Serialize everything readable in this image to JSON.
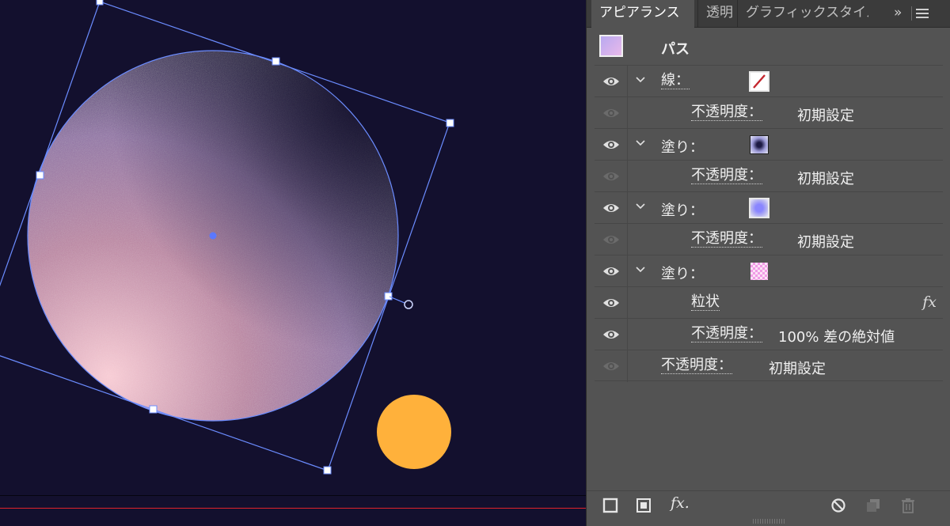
{
  "tabs": [
    {
      "label": "アピアランス",
      "active": true
    },
    {
      "label": "透明",
      "active": false
    },
    {
      "label": "グラフィックスタイル",
      "active": false
    }
  ],
  "tab_overflow": "»",
  "panel_menu_icon": "hamburger-icon",
  "header": {
    "title": "パス"
  },
  "rows": [
    {
      "kind": "stroke",
      "label": "線：",
      "swatch": "stroke-none-swatch"
    },
    {
      "kind": "opacity",
      "label": "不透明度：",
      "value": "初期設定"
    },
    {
      "kind": "fill",
      "label": "塗り：",
      "swatch": "radial-dark-gradient-swatch"
    },
    {
      "kind": "opacity",
      "label": "不透明度：",
      "value": "初期設定"
    },
    {
      "kind": "fill",
      "label": "塗り：",
      "swatch": "radial-lavender-gradient-swatch"
    },
    {
      "kind": "opacity",
      "label": "不透明度：",
      "value": "初期設定"
    },
    {
      "kind": "fill",
      "label": "塗り：",
      "swatch": "pink-pattern-swatch"
    },
    {
      "kind": "effect",
      "label": "粒状",
      "fx": "fx"
    },
    {
      "kind": "opacity",
      "label": "不透明度：",
      "value": "100% 差の絶対値"
    },
    {
      "kind": "opacity-top",
      "label": "不透明度：",
      "value": "初期設定"
    }
  ],
  "bottom_toolbar": {
    "icons": [
      "add-stroke-icon",
      "add-fill-icon",
      "fx-icon",
      "clear-appearance-icon",
      "duplicate-item-icon",
      "delete-item-icon"
    ],
    "fx_label": "fx."
  },
  "colors": {
    "canvas_bg": "#13102e",
    "panel_bg": "#535353",
    "selection": "#6b8cff",
    "sun": "#ffb13b",
    "baseline": "#e0232b"
  }
}
